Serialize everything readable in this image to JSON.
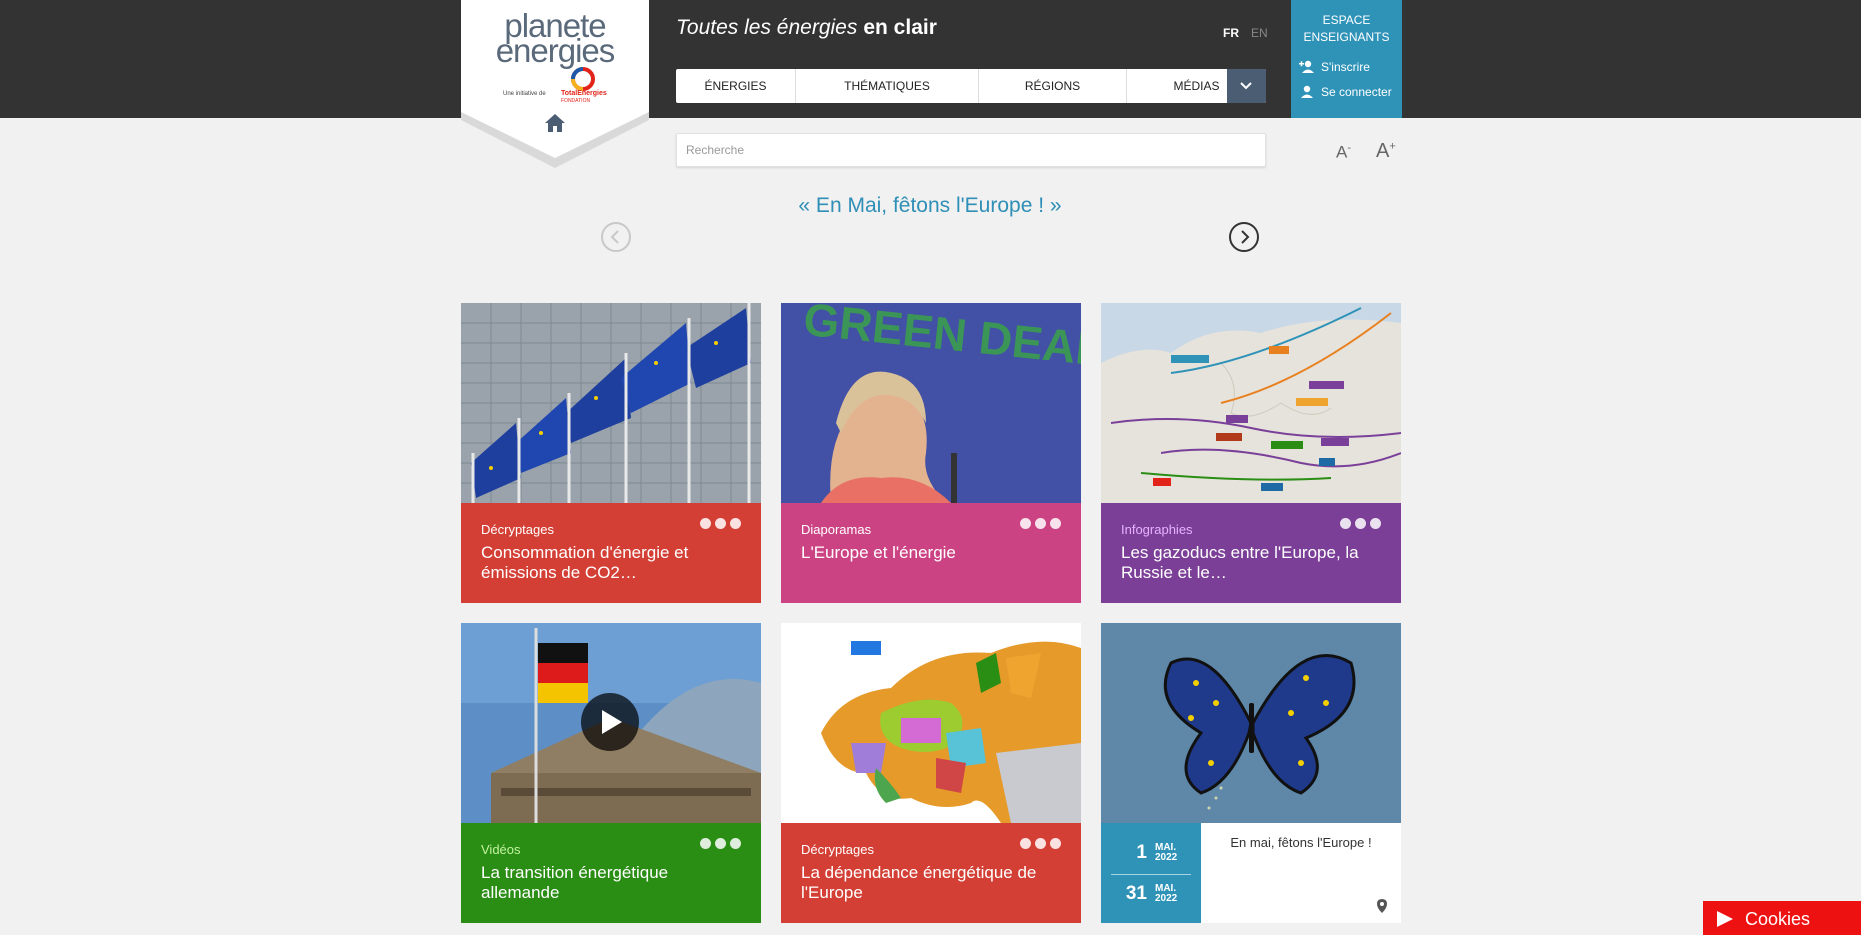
{
  "logo": {
    "word_line1": "planete",
    "word_line2": "energies",
    "initiative_text": "Une initiative de",
    "brand": "TotalEnergies",
    "brand_sub": "FONDATION"
  },
  "header": {
    "tagline_italic": "Toutes les énergies",
    "tagline_bold": "en clair",
    "lang_fr": "FR",
    "lang_en": "EN"
  },
  "nav": {
    "items": [
      "ÉNERGIES",
      "THÉMATIQUES",
      "RÉGIONS",
      "MÉDIAS"
    ]
  },
  "teacher": {
    "title_line1": "ESPACE",
    "title_line2": "ENSEIGNANTS",
    "signup": "S'inscrire",
    "login": "Se connecter"
  },
  "search": {
    "placeholder": "Recherche",
    "value": ""
  },
  "font_size": {
    "decrease": "A",
    "decrease_sup": "-",
    "increase": "A",
    "increase_sup": "+"
  },
  "carousel": {
    "headline": "« En Mai, fêtons l'Europe ! »"
  },
  "cards": [
    {
      "category": "Décryptages",
      "title": "Consommation d'énergie et émissions de CO2…"
    },
    {
      "category": "Diaporamas",
      "title": "L'Europe et l'énergie",
      "image_text": "GREEN DEAL"
    },
    {
      "category": "Infographies",
      "title": "Les gazoducs entre l'Europe, la Russie et le…"
    },
    {
      "category": "Vidéos",
      "title": "La transition énergétique allemande"
    },
    {
      "category": "Décryptages",
      "title": "La dépendance énergétique de l'Europe"
    }
  ],
  "event": {
    "start_day": "1",
    "start_month": "MAI.",
    "start_year": "2022",
    "end_day": "31",
    "end_month": "MAI.",
    "end_year": "2022",
    "title": "En mai, fêtons l'Europe !"
  },
  "cookies": {
    "label": "Cookies"
  },
  "colors": {
    "header_bg": "#333333",
    "teacher_bg": "#2f93b8",
    "decryptages": "#d33f35",
    "diaporamas": "#cc4384",
    "infographies": "#7b3f98",
    "videos": "#2a8d14",
    "cookies": "#ee1111"
  }
}
